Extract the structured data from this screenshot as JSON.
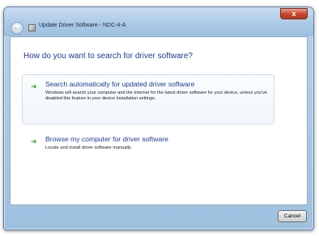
{
  "window": {
    "title": "Update Driver Software - NDC-4-A",
    "close_label": "x"
  },
  "icons": {
    "back": "back-arrow-icon",
    "title": "device-icon",
    "option_arrow": "green-arrow-icon"
  },
  "colors": {
    "heading": "#1f3a93",
    "arrow": "#2f9c1f",
    "close": "#c8432a"
  },
  "content": {
    "heading": "How do you want to search for driver software?",
    "options": [
      {
        "title": "Search automatically for updated driver software",
        "description": "Windows will search your computer and the Internet for the latest driver software for your device, unless you've disabled this feature in your device installation settings."
      },
      {
        "title": "Browse my computer for driver software",
        "description": "Locate and install driver software manually."
      }
    ]
  },
  "footer": {
    "cancel_label": "Cancel"
  }
}
